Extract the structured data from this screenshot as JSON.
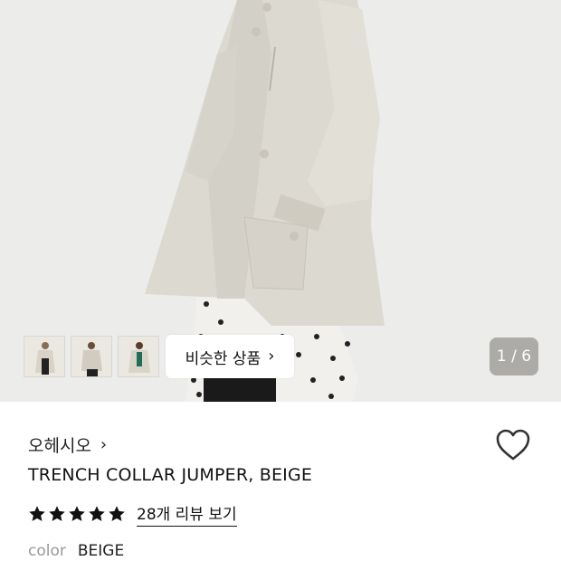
{
  "gallery": {
    "similar_button_label": "비슷한 상품",
    "similar_chevron": "›",
    "counter": "1 / 6",
    "current_index": 1,
    "total_images": 6,
    "thumbnail_count": 3
  },
  "product": {
    "brand": "오헤시오",
    "brand_chevron": "›",
    "title": "TRENCH COLLAR JUMPER, BEIGE",
    "rating_stars": 5,
    "review_link": "28개 리뷰 보기",
    "color_label": "color",
    "color_value": "BEIGE"
  },
  "colors": {
    "star": "#111111",
    "counter_bg": "#78766f",
    "coat": "#dcd9d1",
    "background": "#ececeb"
  },
  "icons": {
    "wishlist": "heart-outline-icon",
    "star": "star-filled-icon"
  }
}
